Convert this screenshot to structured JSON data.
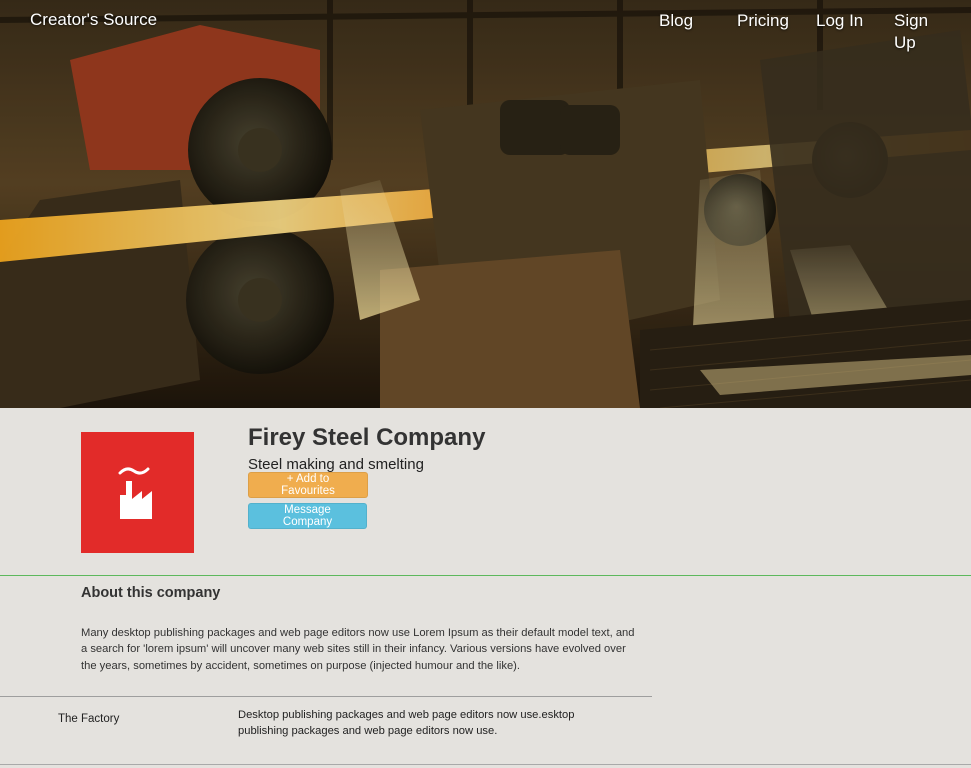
{
  "nav": {
    "brand": "Creator's Source",
    "links": [
      "Blog",
      "Pricing",
      "Log In",
      "Sign Up"
    ]
  },
  "hero": {
    "image": "steel-rolling-mill-photo"
  },
  "company": {
    "name": "Firey Steel Company",
    "tagline": "Steel making and smelting",
    "logo_icon": "factory-icon",
    "logo_color": "#e22b29",
    "favourite_button": "+ Add to Favourites",
    "message_button": "Message Company"
  },
  "about": {
    "heading": "About this company",
    "body": "Many desktop publishing packages and web page editors now use Lorem Ipsum as their default model text, and a search for 'lorem ipsum' will uncover many web sites still in their infancy. Various versions have evolved over the years, sometimes by accident, sometimes on purpose (injected humour and the like)."
  },
  "details": [
    {
      "label": "The Factory",
      "text": "Desktop publishing packages and web page editors now use.esktop publishing packages and web page editors now use."
    }
  ],
  "colors": {
    "favourite": "#f0ad4e",
    "message": "#5bc0de",
    "divider_accent": "#5cb85c"
  }
}
